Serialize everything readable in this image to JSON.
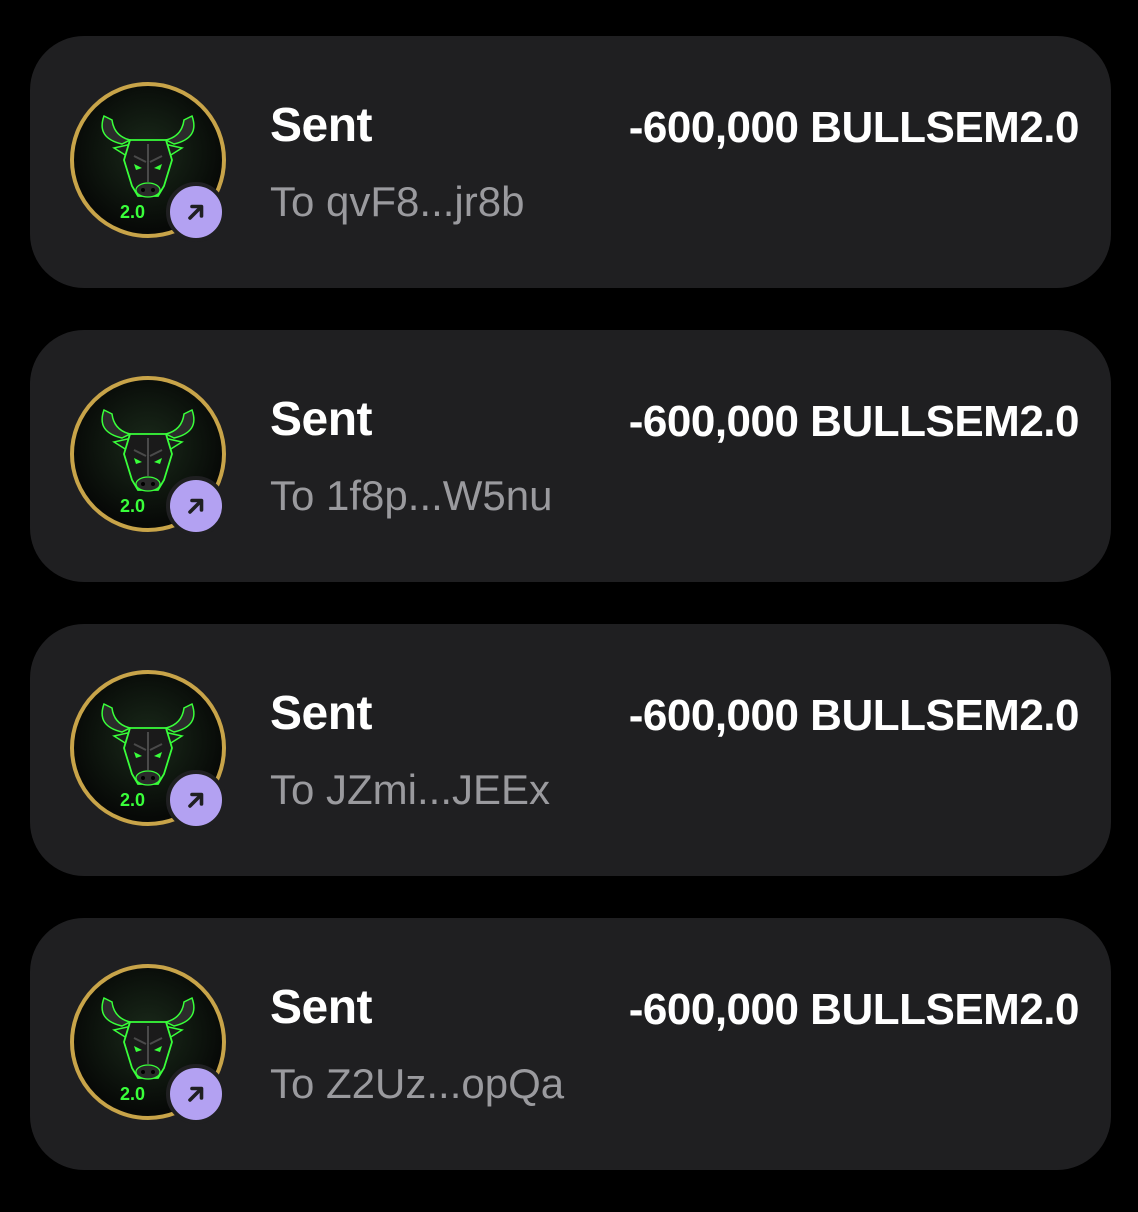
{
  "transactions": [
    {
      "type": "Sent",
      "amount": "-600,000 BULLSEM2.0",
      "recipient": "To qvF8...jr8b",
      "logo_text": "2.0"
    },
    {
      "type": "Sent",
      "amount": "-600,000 BULLSEM2.0",
      "recipient": "To 1f8p...W5nu",
      "logo_text": "2.0"
    },
    {
      "type": "Sent",
      "amount": "-600,000 BULLSEM2.0",
      "recipient": "To JZmi...JEEx",
      "logo_text": "2.0"
    },
    {
      "type": "Sent",
      "amount": "-600,000 BULLSEM2.0",
      "recipient": "To Z2Uz...opQa",
      "logo_text": "2.0"
    }
  ],
  "icons": {
    "token_logo": "bull-head-icon",
    "badge": "arrow-up-right-icon"
  },
  "colors": {
    "background": "#000000",
    "card": "#1f1f21",
    "badge": "#b3a1f2",
    "logo_ring": "#c8a449",
    "logo_glow": "#39ff3a",
    "primary_text": "#ffffff",
    "secondary_text": "#9a9a9e"
  }
}
